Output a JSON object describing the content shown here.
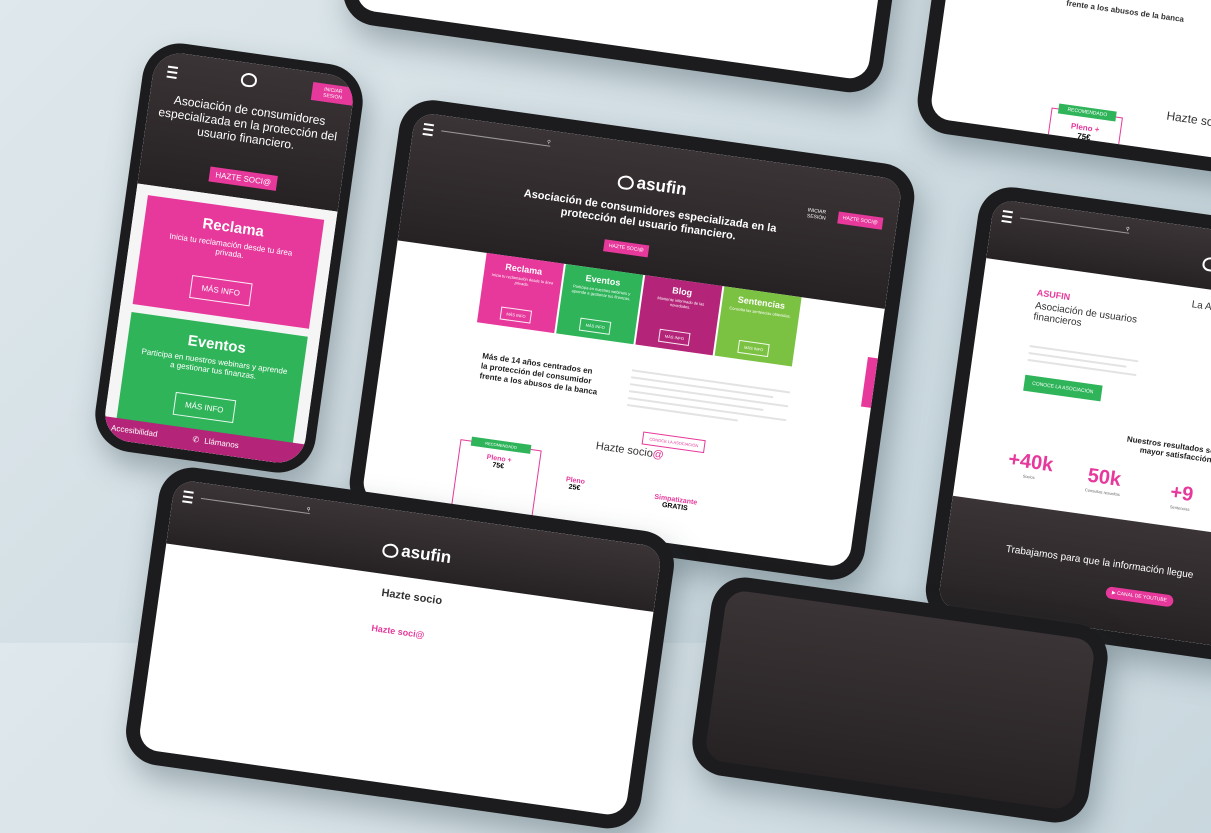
{
  "phone": {
    "login_label": "INICIAR SESIÓN",
    "hero_title": "Asociación de consumidores especializada en la protección del usuario financiero.",
    "cta": "HAZTE SOCI@",
    "cards": [
      {
        "title": "Reclama",
        "text": "Inicia tu reclamación desde tu área privada.",
        "button": "MÁS INFO"
      },
      {
        "title": "Eventos",
        "text": "Participa en nuestros webinars y aprende a gestionar tus finanzas.",
        "button": "MÁS INFO"
      }
    ],
    "footer_left": "Accesibilidad",
    "footer_call": "Llámanos"
  },
  "tablet": {
    "logo": "asufin",
    "header_login": "INICIAR SESIÓN",
    "header_cta": "HAZTE SOCI@",
    "hero_title": "Asociación de consumidores especializada en la protección del usuario financiero.",
    "hero_cta": "HAZTE SOCI@",
    "cards": [
      {
        "title": "Reclama",
        "text": "Inicia tu reclamación desde tu área privada.",
        "button": "MÁS INFO"
      },
      {
        "title": "Eventos",
        "text": "Participa en nuestros webinars y aprende a gestionar tus finanzas.",
        "button": "MÁS INFO"
      },
      {
        "title": "Blog",
        "text": "Mantente informado de las novedades.",
        "button": "MÁS INFO"
      },
      {
        "title": "Sentencias",
        "text": "Consulta las sentencias obtenidas.",
        "button": "MÁS INFO"
      }
    ],
    "about_heading": "Más de 14 años centrados en la protección del consumidor frente a los abusos de la banca",
    "about_button": "CONOCE LA ASOCIACIÓN",
    "plans_heading": "Hazte socio",
    "plans_heading_accent": "@",
    "plans": [
      {
        "badge": "RECOMENDADO",
        "name": "Pleno +",
        "price": "75€"
      },
      {
        "name": "Pleno",
        "price": "25€"
      },
      {
        "name": "Simpatizante",
        "price": "GRATIS"
      }
    ]
  },
  "top_tablet": {
    "text": "frente a los abusos de la banca",
    "label": "Hazte soci@",
    "badge": "RECOMENDADO",
    "plans": [
      {
        "name": "Pleno +",
        "price": "75€"
      },
      {
        "name": "Pleno",
        "price": "25€"
      }
    ]
  },
  "right_tablet": {
    "logo": "asufin",
    "section_title": "La Asoc",
    "brand": "ASUFIN",
    "subtitle": "Asociación de usuarios financieros",
    "button": "CONOCE LA ASOCIACIÓN",
    "results_heading": "Nuestros resultados son n mayor satisfacción",
    "stats": [
      {
        "value": "+40k",
        "label": "Socios"
      },
      {
        "value": "50k",
        "label": "Consultas resueltas"
      },
      {
        "value": "+9",
        "label": "Sentencias"
      }
    ],
    "bottom_text": "Trabajamos para que la información llegue",
    "bottom_bold": "la información",
    "channel": "CANAL DE YOUTUBE"
  },
  "bottom_tablet": {
    "logo": "asufin",
    "title": "Hazte socio",
    "sub": "Hazte soci@"
  }
}
